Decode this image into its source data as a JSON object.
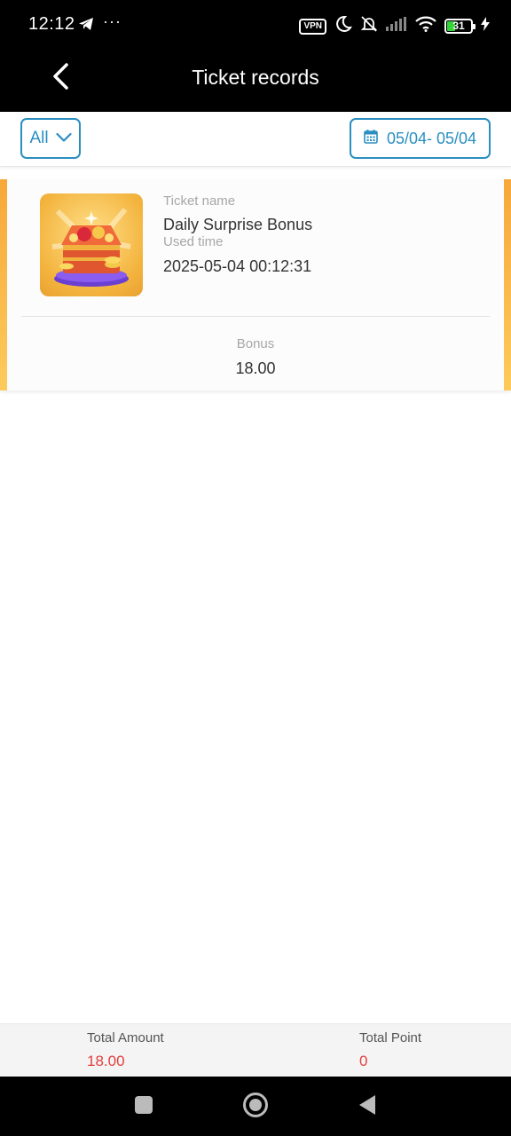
{
  "status_bar": {
    "time": "12:12",
    "more": "···",
    "vpn": "VPN",
    "battery": "31",
    "icons": [
      "telegram-icon",
      "moon-icon",
      "bell-off-icon",
      "signal-icon",
      "wifi-icon",
      "battery-icon",
      "charging-icon"
    ]
  },
  "header": {
    "title": "Ticket records",
    "back_icon": "back-arrow-icon"
  },
  "filters": {
    "type_value": "All",
    "date_range": "05/04- 05/04",
    "accent_color": "#2a8fc0"
  },
  "records": [
    {
      "name_label": "Ticket name",
      "name": "Daily Surprise Bonus",
      "time_label": "Used time",
      "time": "2025-05-04 00:12:31",
      "bonus_label": "Bonus",
      "bonus": "18.00"
    }
  ],
  "totals": {
    "amount_label": "Total Amount",
    "amount": "18.00",
    "point_label": "Total Point",
    "point": "0",
    "value_color": "#e2403f"
  },
  "nav_bar": {
    "icons": [
      "recents-icon",
      "home-icon",
      "back-icon"
    ]
  }
}
